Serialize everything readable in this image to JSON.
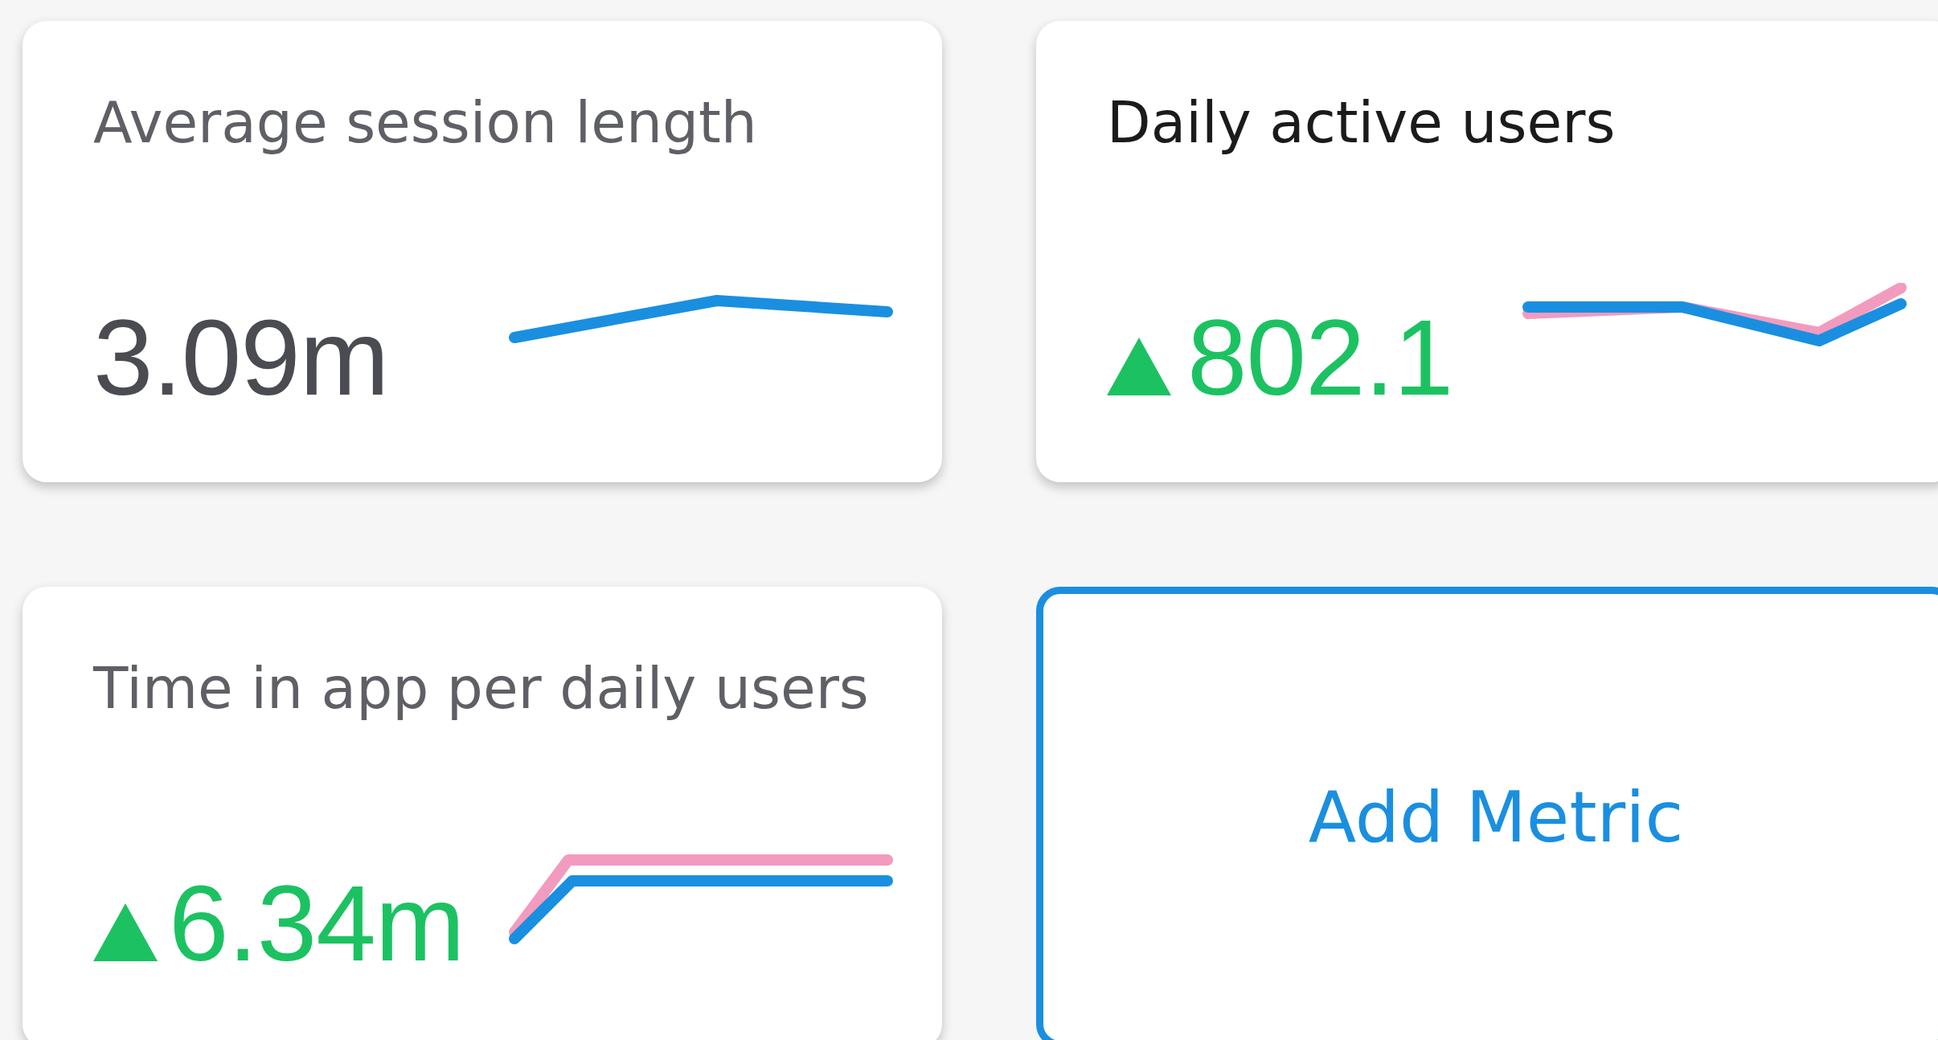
{
  "metrics": [
    {
      "title": "Average session length",
      "emphasized": false,
      "value": "3.09m",
      "rising": false,
      "comparison": false
    },
    {
      "title": "Daily active users",
      "emphasized": true,
      "value": "802.1",
      "rising": true,
      "comparison": true
    },
    {
      "title": "Time in app per daily users",
      "emphasized": false,
      "value": "6.34m",
      "rising": true,
      "comparison": true
    }
  ],
  "add_button": {
    "label": "Add Metric"
  }
}
